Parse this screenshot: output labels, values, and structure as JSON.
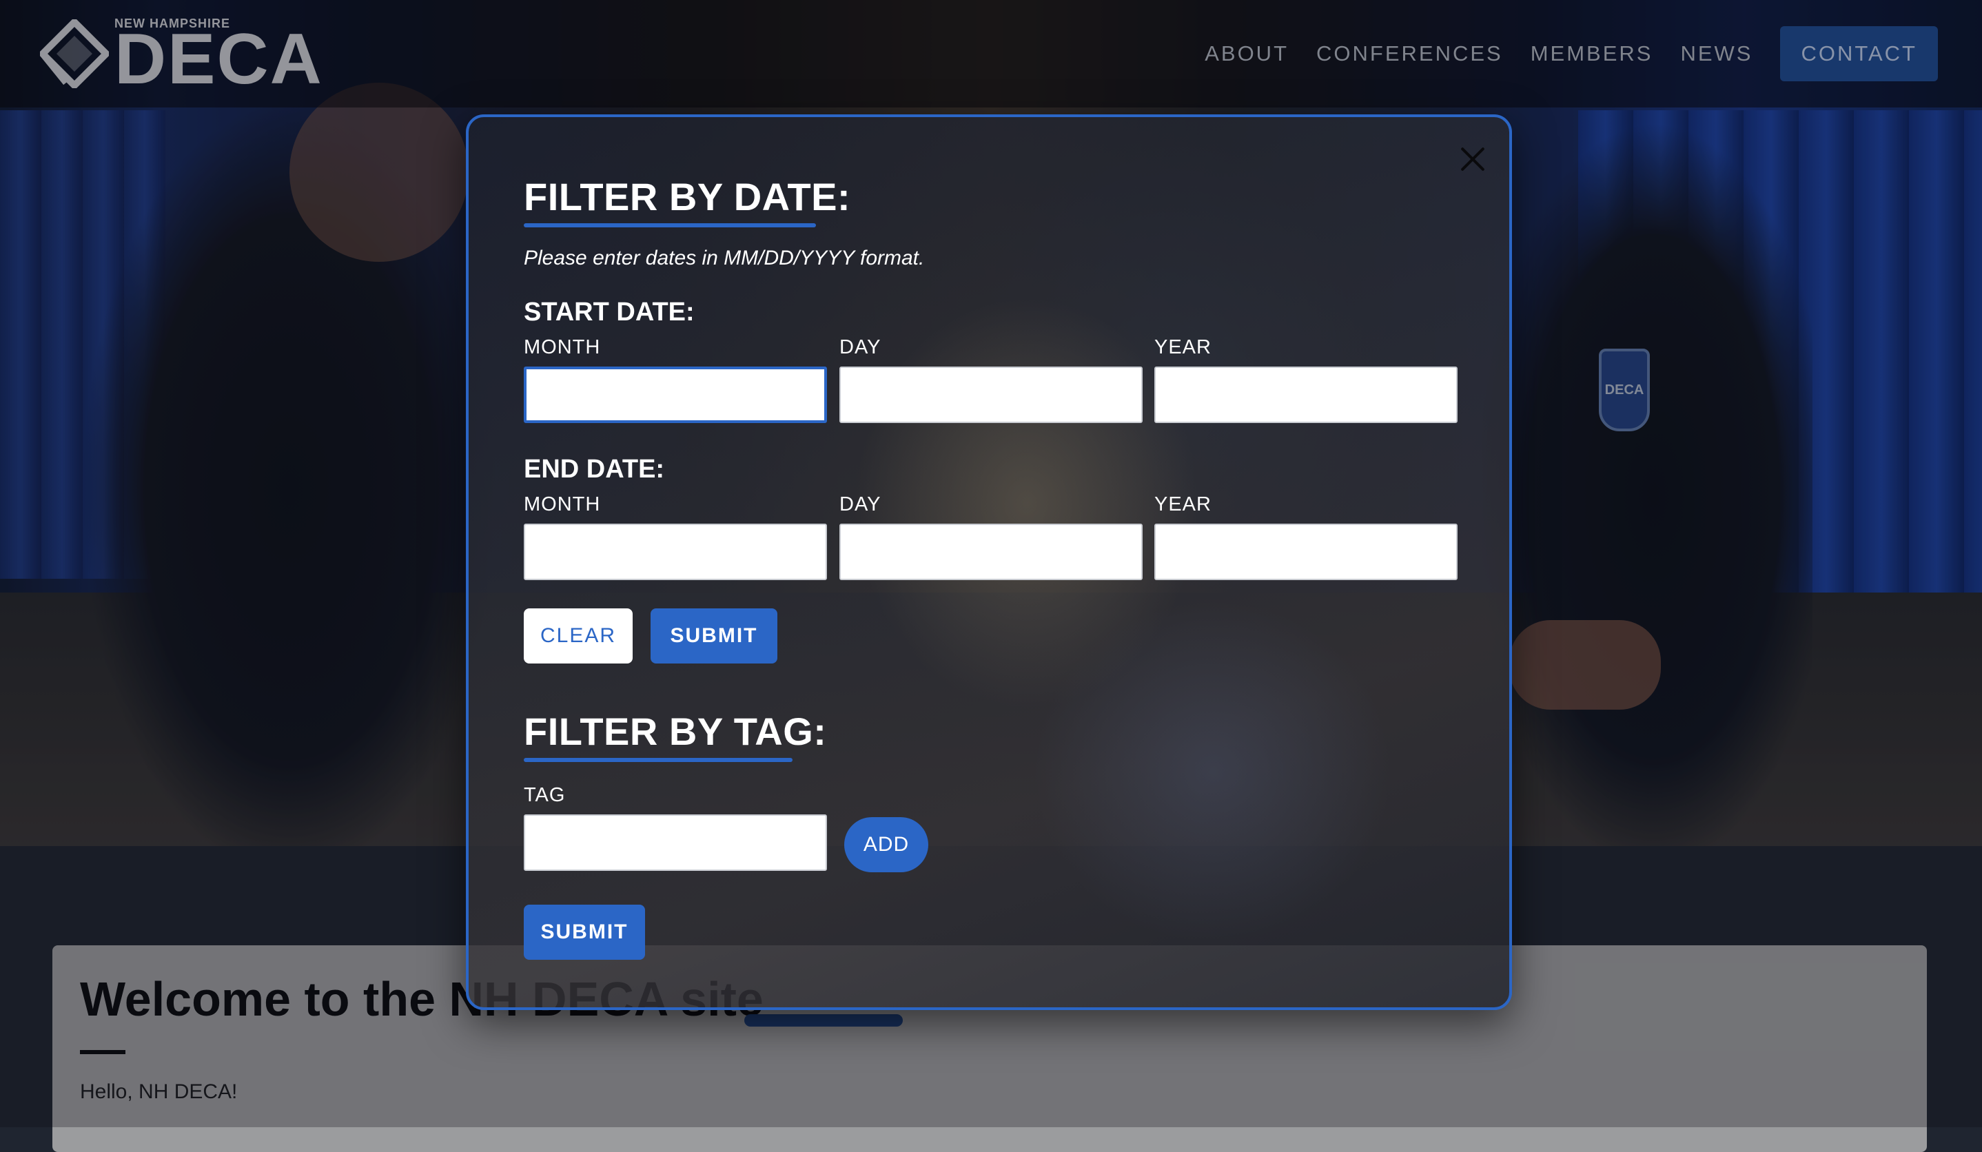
{
  "header": {
    "logo_small": "NEW HAMPSHIRE",
    "logo_word": "DECA",
    "nav": {
      "about": "ABOUT",
      "conferences": "CONFERENCES",
      "members": "MEMBERS",
      "news": "NEWS",
      "contact": "CONTACT"
    }
  },
  "hero": {
    "badge_text": "DECA"
  },
  "page": {
    "welcome_title": "Welcome to the NH DECA site",
    "hello": "Hello, NH DECA!"
  },
  "modal": {
    "date_heading": "FILTER BY DATE:",
    "date_note": "Please enter dates in MM/DD/YYYY format.",
    "start_label": "START DATE:",
    "end_label": "END DATE:",
    "month_label": "MONTH",
    "day_label": "DAY",
    "year_label": "YEAR",
    "start_month_value": "",
    "start_day_value": "",
    "start_year_value": "",
    "end_month_value": "",
    "end_day_value": "",
    "end_year_value": "",
    "clear_label": "CLEAR",
    "date_submit_label": "SUBMIT",
    "tag_heading": "FILTER BY TAG:",
    "tag_label": "TAG",
    "tag_value": "",
    "add_label": "ADD",
    "tag_submit_label": "SUBMIT"
  },
  "colors": {
    "accent": "#2b66c6",
    "contact_button": "#1e4a8f"
  },
  "icons": {
    "close": "close-icon",
    "logo": "deca-diamond-icon"
  }
}
